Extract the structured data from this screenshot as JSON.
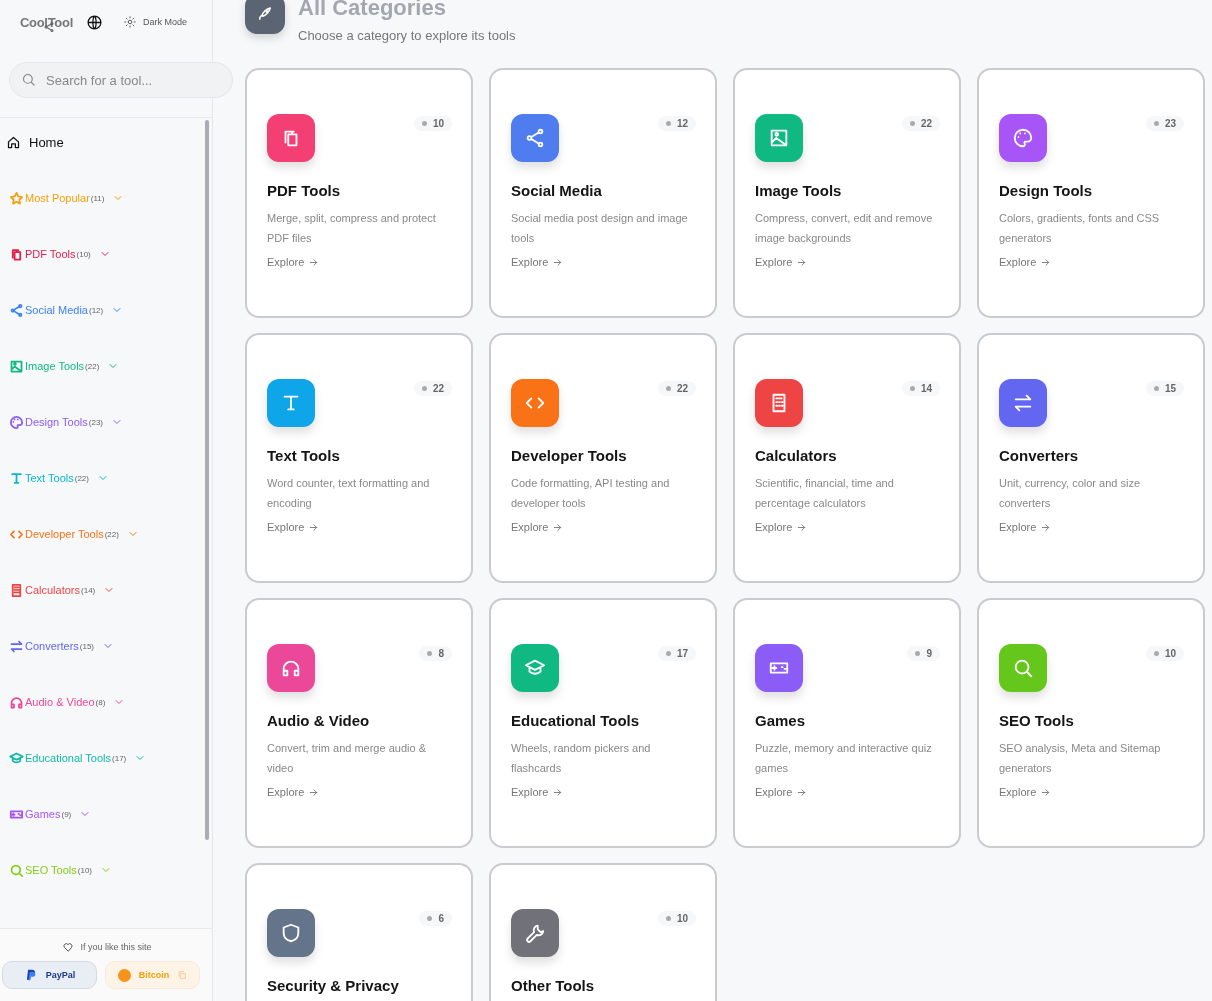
{
  "sidebar": {
    "logo": "CoolTool",
    "dark_mode": "Dark Mode",
    "search": {
      "placeholder": "Search for a tool..."
    },
    "home": "Home",
    "items": [
      {
        "label": "Most Popular",
        "count": "(11)",
        "color": "#f59e0b"
      },
      {
        "label": "PDF Tools",
        "count": "(10)",
        "color": "#e11d48"
      },
      {
        "label": "Social Media",
        "count": "(12)",
        "color": "#3b82f6"
      },
      {
        "label": "Image Tools",
        "count": "(22)",
        "color": "#10b981"
      },
      {
        "label": "Design Tools",
        "count": "(23)",
        "color": "#8b5cf6"
      },
      {
        "label": "Text Tools",
        "count": "(22)",
        "color": "#06b6d4"
      },
      {
        "label": "Developer Tools",
        "count": "(22)",
        "color": "#f97316"
      },
      {
        "label": "Calculators",
        "count": "(14)",
        "color": "#ef4444"
      },
      {
        "label": "Converters",
        "count": "(15)",
        "color": "#6366f1"
      },
      {
        "label": "Audio & Video",
        "count": "(8)",
        "color": "#ec4899"
      },
      {
        "label": "Educational Tools",
        "count": "(17)",
        "color": "#14b8a6"
      },
      {
        "label": "Games",
        "count": "(9)",
        "color": "#a855f7"
      },
      {
        "label": "SEO Tools",
        "count": "(10)",
        "color": "#84cc16"
      }
    ],
    "support": "If you like this site",
    "paypal": "PayPal",
    "bitcoin": "Bitcoin"
  },
  "header": {
    "title": "All Categories",
    "subtitle": "Choose a category to explore its tools"
  },
  "cards": [
    {
      "title": "PDF Tools",
      "count": "10",
      "description": "Merge, split, compress and protect PDF files",
      "link": "Explore",
      "color": "#f43f75"
    },
    {
      "title": "Social Media",
      "count": "12",
      "description": "Social media post design and image tools",
      "link": "Explore",
      "color": "#4f7df0"
    },
    {
      "title": "Image Tools",
      "count": "22",
      "description": "Compress, convert, edit and remove image backgrounds",
      "link": "Explore",
      "color": "#10b981"
    },
    {
      "title": "Design Tools",
      "count": "23",
      "description": "Colors, gradients, fonts and CSS generators",
      "link": "Explore",
      "color": "#a855f7"
    },
    {
      "title": "Text Tools",
      "count": "22",
      "description": "Word counter, text formatting and encoding",
      "link": "Explore",
      "color": "#0ea5e9"
    },
    {
      "title": "Developer Tools",
      "count": "22",
      "description": "Code formatting, API testing and developer tools",
      "link": "Explore",
      "color": "#f97316"
    },
    {
      "title": "Calculators",
      "count": "14",
      "description": "Scientific, financial, time and percentage calculators",
      "link": "Explore",
      "color": "#ef4444"
    },
    {
      "title": "Converters",
      "count": "15",
      "description": "Unit, currency, color and size converters",
      "link": "Explore",
      "color": "#6366f1"
    },
    {
      "title": "Audio & Video",
      "count": "8",
      "description": "Convert, trim and merge audio & video",
      "link": "Explore",
      "color": "#ec4899"
    },
    {
      "title": "Educational Tools",
      "count": "17",
      "description": "Wheels, random pickers and flashcards",
      "link": "Explore",
      "color": "#10b981"
    },
    {
      "title": "Games",
      "count": "9",
      "description": "Puzzle, memory and interactive quiz games",
      "link": "Explore",
      "color": "#8b5cf6"
    },
    {
      "title": "SEO Tools",
      "count": "10",
      "description": "SEO analysis, Meta and Sitemap generators",
      "link": "Explore",
      "color": "#65c61b"
    },
    {
      "title": "Security & Privacy",
      "count": "6",
      "color": "#64748b"
    },
    {
      "title": "Other Tools",
      "count": "10",
      "color": "#71717a"
    }
  ]
}
